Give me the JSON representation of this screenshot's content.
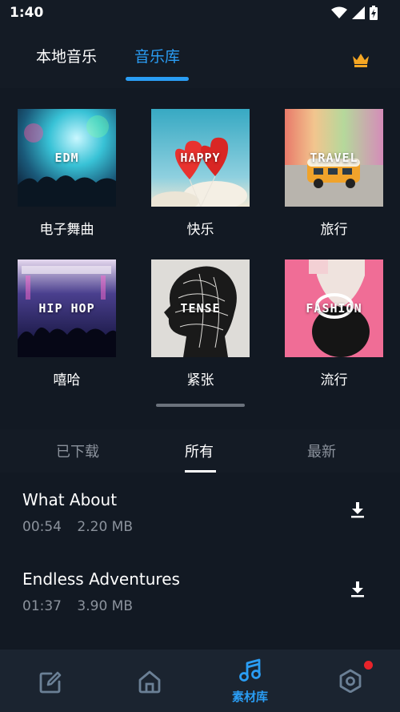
{
  "status_bar": {
    "time": "1:40"
  },
  "top_tabs": [
    {
      "label": "本地音乐",
      "active": false
    },
    {
      "label": "音乐库",
      "active": true
    }
  ],
  "premium_icon": "crown-icon",
  "genres": [
    {
      "label": "电子舞曲",
      "cover_text": "EDM"
    },
    {
      "label": "快乐",
      "cover_text": "HAPPY"
    },
    {
      "label": "旅行",
      "cover_text": "TRAVEL"
    },
    {
      "label": "嘻哈",
      "cover_text": "HIP HOP"
    },
    {
      "label": "紧张",
      "cover_text": "TENSE"
    },
    {
      "label": "流行",
      "cover_text": "FASHION"
    }
  ],
  "sub_tabs": [
    {
      "label": "已下载",
      "active": false
    },
    {
      "label": "所有",
      "active": true
    },
    {
      "label": "最新",
      "active": false
    }
  ],
  "tracks": [
    {
      "title": "What About",
      "duration": "00:54",
      "size": "2.20 MB"
    },
    {
      "title": "Endless Adventures",
      "duration": "01:37",
      "size": "3.90 MB"
    }
  ],
  "bottom_nav": [
    {
      "icon": "edit-icon",
      "label": ""
    },
    {
      "icon": "home-icon",
      "label": ""
    },
    {
      "icon": "music-note-icon",
      "label": "素材库",
      "active": true
    },
    {
      "icon": "settings-hexagon-icon",
      "label": "",
      "badge": true
    }
  ],
  "colors": {
    "accent": "#2a9df4",
    "background": "#121923",
    "badge": "#e8232a"
  }
}
